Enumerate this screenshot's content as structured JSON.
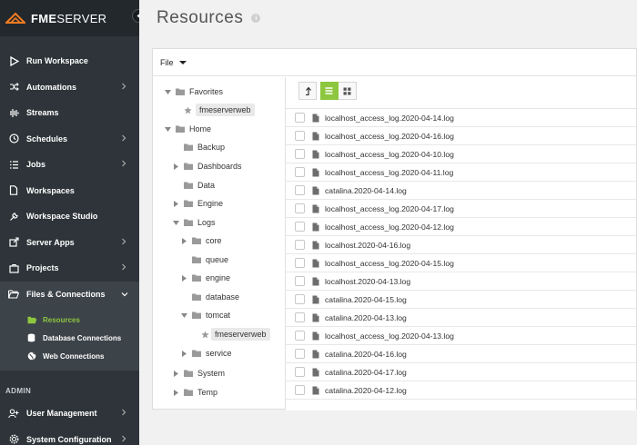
{
  "brand": {
    "prefix": "FME",
    "suffix": "SERVER"
  },
  "header": {
    "title": "Resources",
    "info_glyph": "i"
  },
  "sidebar": {
    "items": [
      {
        "label": "Run Workspace",
        "icon": "play-icon",
        "chevron": false
      },
      {
        "label": "Automations",
        "icon": "shuffle-icon",
        "chevron": true
      },
      {
        "label": "Streams",
        "icon": "waveform-icon",
        "chevron": false
      },
      {
        "label": "Schedules",
        "icon": "clock-icon",
        "chevron": true
      },
      {
        "label": "Jobs",
        "icon": "list-icon",
        "chevron": true
      },
      {
        "label": "Workspaces",
        "icon": "document-icon",
        "chevron": false
      },
      {
        "label": "Workspace Studio",
        "icon": "wrench-icon",
        "chevron": false
      },
      {
        "label": "Server Apps",
        "icon": "app-share-icon",
        "chevron": true
      },
      {
        "label": "Projects",
        "icon": "briefcase-icon",
        "chevron": true
      },
      {
        "label": "Files & Connections",
        "icon": "folder-open-icon",
        "chevron": true
      }
    ],
    "sub_items": [
      {
        "label": "Resources",
        "icon": "folder-open-icon"
      },
      {
        "label": "Database Connections",
        "icon": "database-icon"
      },
      {
        "label": "Web Connections",
        "icon": "globe-icon"
      }
    ],
    "admin_label": "ADMIN",
    "admin_items": [
      {
        "label": "User Management",
        "icon": "user-plus-icon",
        "chevron": true
      },
      {
        "label": "System Configuration",
        "icon": "gear-icon",
        "chevron": true
      }
    ]
  },
  "toolbar": {
    "file_menu": "File"
  },
  "tree": {
    "favorites": "Favorites",
    "fav_item": "fmeserverweb",
    "home": "Home",
    "backup": "Backup",
    "dashboards": "Dashboards",
    "data": "Data",
    "engine": "Engine",
    "logs": "Logs",
    "core": "core",
    "queue": "queue",
    "engine_sub": "engine",
    "database": "database",
    "tomcat": "tomcat",
    "tomcat_item": "fmeserverweb",
    "service": "service",
    "system": "System",
    "temp": "Temp"
  },
  "files": [
    "localhost_access_log.2020-04-14.log",
    "localhost_access_log.2020-04-16.log",
    "localhost_access_log.2020-04-10.log",
    "localhost_access_log.2020-04-11.log",
    "catalina.2020-04-14.log",
    "localhost_access_log.2020-04-17.log",
    "localhost_access_log.2020-04-12.log",
    "localhost.2020-04-16.log",
    "localhost_access_log.2020-04-15.log",
    "localhost.2020-04-13.log",
    "catalina.2020-04-15.log",
    "catalina.2020-04-13.log",
    "localhost_access_log.2020-04-13.log",
    "catalina.2020-04-16.log",
    "catalina.2020-04-17.log",
    "catalina.2020-04-12.log"
  ],
  "colors": {
    "accent": "#8dc63f",
    "sidebar": "#2e3439",
    "brand_bar": "#23282c"
  }
}
